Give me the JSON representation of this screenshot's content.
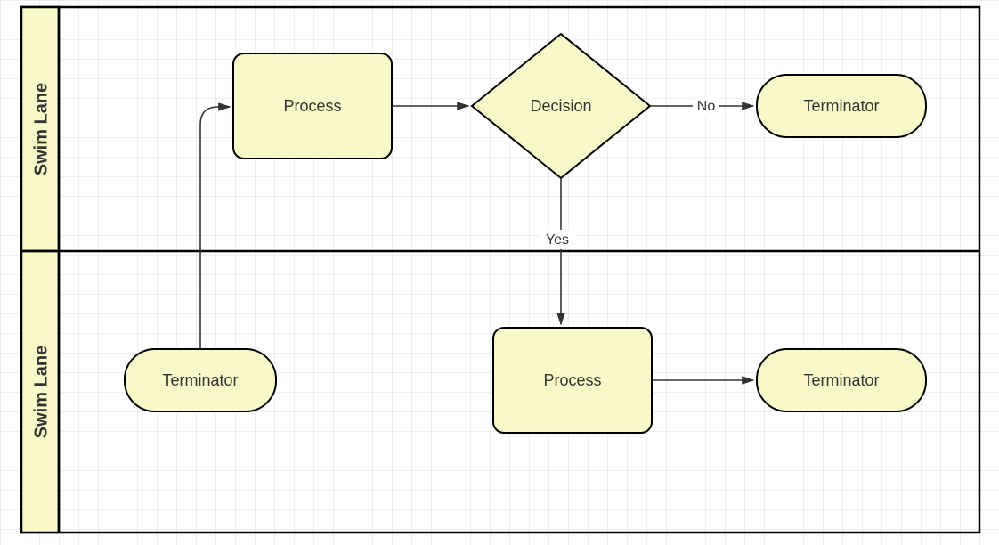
{
  "lanes": {
    "top": "Swim Lane",
    "bottom": "Swim Lane"
  },
  "nodes": {
    "process1": "Process",
    "decision": "Decision",
    "terminator_top": "Terminator",
    "terminator_start": "Terminator",
    "process2": "Process",
    "terminator_end": "Terminator"
  },
  "edges": {
    "decision_no": "No",
    "decision_yes": "Yes"
  },
  "colors": {
    "fill": "#f8f8c8",
    "stroke": "#000000",
    "lane_header": "#f8f8c8"
  }
}
